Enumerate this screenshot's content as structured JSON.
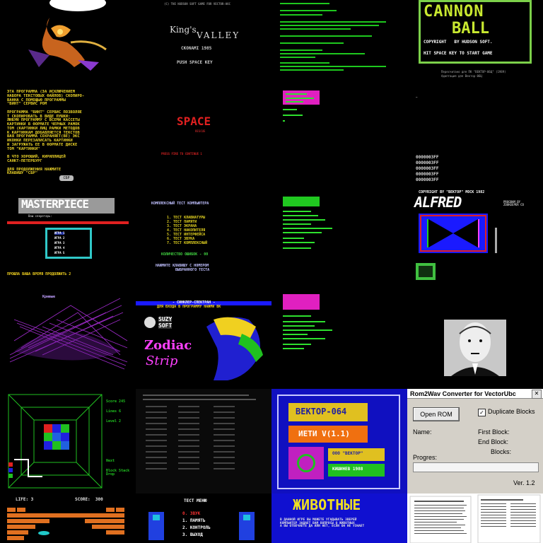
{
  "tiles": {
    "r0c1": {
      "top_text": "(C) THE HUDSON SOFT GAME FOR VECTOR-06C",
      "title_a": "King's",
      "title_b": "VALLEY",
      "brand": "CKONAMI 1985",
      "prompt": "PUSH SPACE KEY"
    },
    "r0c3": {
      "title_a": "CANNON",
      "title_b": "BALL",
      "copyright": "COPYRIGHT   BY HUDSON SOFT.",
      "prompt": "HIT SPACE KEY TO START GAME",
      "footer_a": "Пересчитано для ПК \"ВЕКТОР-06Ц\" (1989)",
      "footer_b": "Адаптация для Вектор-06Ц"
    },
    "r1c0": {
      "body": "ЭТА ПРОГРАММА (ЭА ИСКЛЮЧЕНИЕМ\nНАБОРА ТЕКСТОВЫХ ФАЙЛОВ) СКОПИРО-\nВАННА С ПОМОЩЬЮ ПРОГРАММЫ\n\"ВИНТ\" СЕРВИС РОМ\n\nПРОГРАММА \"ВИНТ\" СЕРВИС ПОЗВОЛЯЕ\nТ СКОПИРОВАТЬ В ВИДЕ ПУШКИ:\nЛЮБУЮ ПРОГРАММУ С ВСЕМИ КАССЕТЫ\nКАРТИНКИ В ФОРМАТЕ ЧЕРНЫХ РАМОК\nТОМ (КАРТИНКИ ЛИЦ РАМКИ МЕТОДОВ\nК КАРТИНКАМ ДОБАВЛЯЕТСЯ ТЕКСТОВ\nВАЯ ПРОГРАММА СОХРАНЯЕТ(ВЕ) ЭКС\nИКОНКИ ПЕРЕЗАПИСАТЬ КАРТИНКИ\nИ ЗАГРУЖАТЬ ЕЕ В ФОРМАТЕ ДИСКЕ\nТОМ \"КАРТИНКИ\"\n\nВ ЧТО ХОРОШИЙ, КИРИЛЛИЦЕЙ\nСАНКТ-ПЕТЕРБУРГ\n\nДЛЯ ПРОДОЛЖЕНИЯ НАЖМИТЕ\nКЛАВИШУ \"СБР\"",
      "key": "СБР"
    },
    "r1c1": {
      "title": "SPACE",
      "sub": "RESCUE",
      "foot": "PRESS FIRE TO CONTINUE 1"
    },
    "r1c3": {
      "lines": [
        "0000003FF",
        "0000003FF",
        "0000003FF",
        "0000003FF",
        "0000003FF"
      ]
    },
    "r2c0": {
      "logo": "MASTERPIECE",
      "sub": "Ваш секретарь:",
      "menu": [
        "ИГРА 1",
        "ИГРА 2",
        "ИГРА 3",
        "ИГРА 4",
        "ИГРА 5"
      ],
      "foot": "ПРОШЛА ВАША ВРЕМЯ ПРОДОЛЖИТЬ 2"
    },
    "r2c1": {
      "title": "КОМПЛЕКСНЫЙ ТЕСТ КОМПЬЮТЕРА",
      "items": [
        "1. ТЕСТ КЛАВИАТУРЫ",
        "2. ТЕСТ ПАМЯТИ",
        "3. ТЕСТ ЭКРАНА",
        "4. ТЕСТ НАКОПИТЕЛЯ",
        "5. ТЕСТ ИНТЕРФЕЙСА",
        "6. ТЕСТ ЗВУКА",
        "7. ТЕСТ КОМПЛЕКСНЫЙ"
      ],
      "count": "КОЛИЧЕСТВО ОШИБОК - 00",
      "foot_a": "НАЖМИТЕ КЛАВИШУ С НОМЕРОМ",
      "foot_b": "ВЫБРАННОГО ТЕСТА"
    },
    "r2c3": {
      "head": "COPYRIGHT BY \"BEKTOP\" MOCK 1982",
      "logo": "ALFRED",
      "side": "PROGRAM BY ZOOKEEPER CO"
    },
    "r3c0": {
      "label": "Кривые"
    },
    "r3c1": {
      "head_a": "- СИНКЛЕР-СПЕКТРАН -",
      "head_b": "ДЛЯ ВХОДА В ПРОГРАММУ НАЖМИ ВК",
      "brand_a": "SUZY",
      "brand_b": "SOFT",
      "title_a": "Zodiac",
      "title_b": "Strip"
    },
    "r4c0": {
      "labels": [
        "Score 245",
        "Lines 6",
        "Level 2",
        "Next",
        "Block Stack Drop"
      ]
    },
    "r4c2": {
      "line1": "ВЕКТОР-064",
      "line2": "ИЕТИ V(1.1)",
      "line3": "ООО \"ВЕКТОР\"",
      "line4": "КИШИНЕВ 1988"
    },
    "r4c3": {
      "window_title": "Rom2Wav Converter for VectorUbc",
      "open_rom": "Open ROM",
      "dup": "Duplicate Blocks",
      "name": "Name:",
      "first": "First Block:",
      "end": "End Block:",
      "blocks": "Blocks:",
      "progress": "Progres:",
      "version": "Ver. 1.2"
    },
    "r5c0": {
      "life": "LIFE: 3",
      "score": "SCORE:  300"
    },
    "r5c1": {
      "title": "ТЕСТ МЕНЮ",
      "items": [
        "0. ЗВУК",
        "1. ПАМЯТЬ",
        "2. КОНТРОЛЬ",
        "3. ВЫХОД"
      ]
    },
    "r5c2": {
      "title": "ЖИВОТНЫЕ",
      "body": "В ДАННОЙ ИГРЕ ВЫ МОЖЕТЕ УГАДЫВАТЬ ЗВЕРЕЙ\nКОМПЬЮТЕР ЗАДАЕТ ВАМ ВОПРОСЫ О ЖИВОТНЫХ\nА ВЫ ОТВЕЧАЕТЕ ДА ИЛИ НЕТ, ЕСЛИ ОН НЕ УЗНАЕТ"
    }
  }
}
